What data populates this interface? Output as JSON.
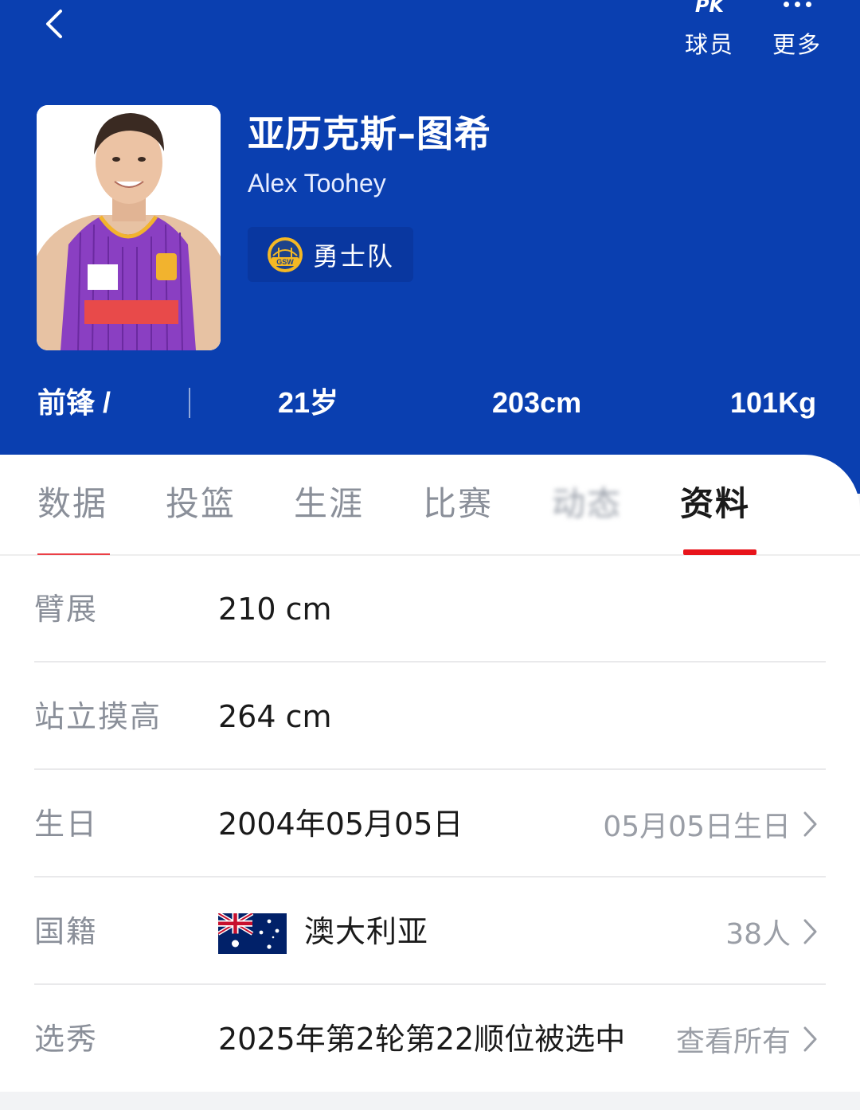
{
  "header": {
    "pk_glyph": "PK",
    "pk_label": "球员",
    "more_label": "更多",
    "bg_color": "#0a3fb0"
  },
  "player": {
    "name_cn": "亚历克斯–图希",
    "name_en": "Alex Toohey",
    "team": "勇士队",
    "team_logo_text": "GSW"
  },
  "stats": {
    "position": "前锋 /",
    "age": "21岁",
    "height": "203cm",
    "weight": "101Kg"
  },
  "tabs": [
    {
      "label": "数据"
    },
    {
      "label": "投篮"
    },
    {
      "label": "生涯"
    },
    {
      "label": "比赛"
    },
    {
      "label": "动态"
    },
    {
      "label": "资料",
      "active": true
    }
  ],
  "profile": {
    "wingspan": {
      "key": "臂展",
      "value": "210 cm"
    },
    "reach": {
      "key": "站立摸高",
      "value": "264 cm"
    },
    "birthday": {
      "key": "生日",
      "value": "2004年05月05日",
      "link": "05月05日生日"
    },
    "nationality": {
      "key": "国籍",
      "value": "澳大利亚",
      "link": "38人"
    },
    "draft": {
      "key": "选秀",
      "value": "2025年第2轮第22顺位被选中",
      "link": "查看所有"
    }
  },
  "colors": {
    "accent_red": "#e8141b",
    "jersey_purple": "#8a3fc2"
  }
}
